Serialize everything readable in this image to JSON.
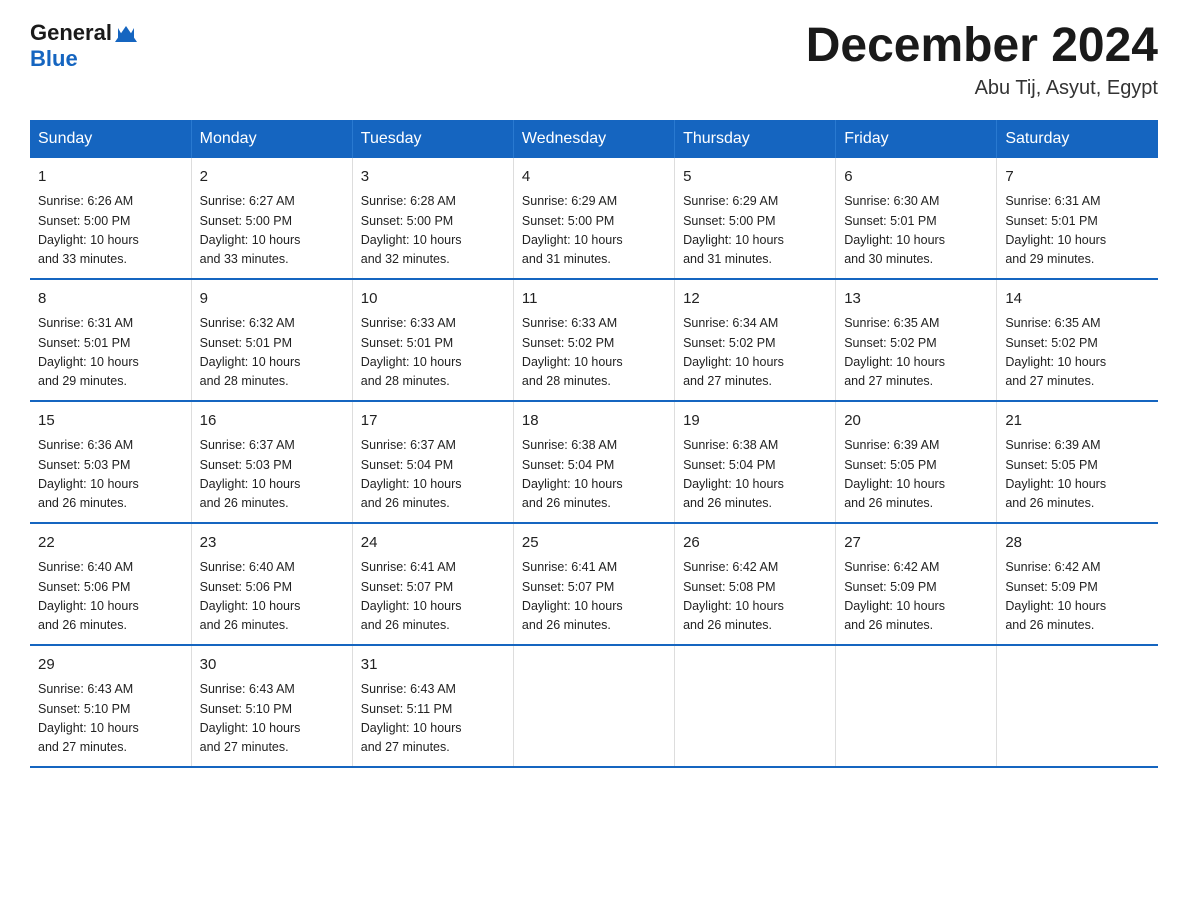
{
  "header": {
    "logo_text_general": "General",
    "logo_text_blue": "Blue",
    "title": "December 2024",
    "subtitle": "Abu Tij, Asyut, Egypt"
  },
  "days_of_week": [
    "Sunday",
    "Monday",
    "Tuesday",
    "Wednesday",
    "Thursday",
    "Friday",
    "Saturday"
  ],
  "weeks": [
    [
      {
        "day": "1",
        "sunrise": "6:26 AM",
        "sunset": "5:00 PM",
        "daylight": "10 hours and 33 minutes."
      },
      {
        "day": "2",
        "sunrise": "6:27 AM",
        "sunset": "5:00 PM",
        "daylight": "10 hours and 33 minutes."
      },
      {
        "day": "3",
        "sunrise": "6:28 AM",
        "sunset": "5:00 PM",
        "daylight": "10 hours and 32 minutes."
      },
      {
        "day": "4",
        "sunrise": "6:29 AM",
        "sunset": "5:00 PM",
        "daylight": "10 hours and 31 minutes."
      },
      {
        "day": "5",
        "sunrise": "6:29 AM",
        "sunset": "5:00 PM",
        "daylight": "10 hours and 31 minutes."
      },
      {
        "day": "6",
        "sunrise": "6:30 AM",
        "sunset": "5:01 PM",
        "daylight": "10 hours and 30 minutes."
      },
      {
        "day": "7",
        "sunrise": "6:31 AM",
        "sunset": "5:01 PM",
        "daylight": "10 hours and 29 minutes."
      }
    ],
    [
      {
        "day": "8",
        "sunrise": "6:31 AM",
        "sunset": "5:01 PM",
        "daylight": "10 hours and 29 minutes."
      },
      {
        "day": "9",
        "sunrise": "6:32 AM",
        "sunset": "5:01 PM",
        "daylight": "10 hours and 28 minutes."
      },
      {
        "day": "10",
        "sunrise": "6:33 AM",
        "sunset": "5:01 PM",
        "daylight": "10 hours and 28 minutes."
      },
      {
        "day": "11",
        "sunrise": "6:33 AM",
        "sunset": "5:02 PM",
        "daylight": "10 hours and 28 minutes."
      },
      {
        "day": "12",
        "sunrise": "6:34 AM",
        "sunset": "5:02 PM",
        "daylight": "10 hours and 27 minutes."
      },
      {
        "day": "13",
        "sunrise": "6:35 AM",
        "sunset": "5:02 PM",
        "daylight": "10 hours and 27 minutes."
      },
      {
        "day": "14",
        "sunrise": "6:35 AM",
        "sunset": "5:02 PM",
        "daylight": "10 hours and 27 minutes."
      }
    ],
    [
      {
        "day": "15",
        "sunrise": "6:36 AM",
        "sunset": "5:03 PM",
        "daylight": "10 hours and 26 minutes."
      },
      {
        "day": "16",
        "sunrise": "6:37 AM",
        "sunset": "5:03 PM",
        "daylight": "10 hours and 26 minutes."
      },
      {
        "day": "17",
        "sunrise": "6:37 AM",
        "sunset": "5:04 PM",
        "daylight": "10 hours and 26 minutes."
      },
      {
        "day": "18",
        "sunrise": "6:38 AM",
        "sunset": "5:04 PM",
        "daylight": "10 hours and 26 minutes."
      },
      {
        "day": "19",
        "sunrise": "6:38 AM",
        "sunset": "5:04 PM",
        "daylight": "10 hours and 26 minutes."
      },
      {
        "day": "20",
        "sunrise": "6:39 AM",
        "sunset": "5:05 PM",
        "daylight": "10 hours and 26 minutes."
      },
      {
        "day": "21",
        "sunrise": "6:39 AM",
        "sunset": "5:05 PM",
        "daylight": "10 hours and 26 minutes."
      }
    ],
    [
      {
        "day": "22",
        "sunrise": "6:40 AM",
        "sunset": "5:06 PM",
        "daylight": "10 hours and 26 minutes."
      },
      {
        "day": "23",
        "sunrise": "6:40 AM",
        "sunset": "5:06 PM",
        "daylight": "10 hours and 26 minutes."
      },
      {
        "day": "24",
        "sunrise": "6:41 AM",
        "sunset": "5:07 PM",
        "daylight": "10 hours and 26 minutes."
      },
      {
        "day": "25",
        "sunrise": "6:41 AM",
        "sunset": "5:07 PM",
        "daylight": "10 hours and 26 minutes."
      },
      {
        "day": "26",
        "sunrise": "6:42 AM",
        "sunset": "5:08 PM",
        "daylight": "10 hours and 26 minutes."
      },
      {
        "day": "27",
        "sunrise": "6:42 AM",
        "sunset": "5:09 PM",
        "daylight": "10 hours and 26 minutes."
      },
      {
        "day": "28",
        "sunrise": "6:42 AM",
        "sunset": "5:09 PM",
        "daylight": "10 hours and 26 minutes."
      }
    ],
    [
      {
        "day": "29",
        "sunrise": "6:43 AM",
        "sunset": "5:10 PM",
        "daylight": "10 hours and 27 minutes."
      },
      {
        "day": "30",
        "sunrise": "6:43 AM",
        "sunset": "5:10 PM",
        "daylight": "10 hours and 27 minutes."
      },
      {
        "day": "31",
        "sunrise": "6:43 AM",
        "sunset": "5:11 PM",
        "daylight": "10 hours and 27 minutes."
      },
      {
        "day": "",
        "sunrise": "",
        "sunset": "",
        "daylight": ""
      },
      {
        "day": "",
        "sunrise": "",
        "sunset": "",
        "daylight": ""
      },
      {
        "day": "",
        "sunrise": "",
        "sunset": "",
        "daylight": ""
      },
      {
        "day": "",
        "sunrise": "",
        "sunset": "",
        "daylight": ""
      }
    ]
  ],
  "labels": {
    "sunrise_prefix": "Sunrise: ",
    "sunset_prefix": "Sunset: ",
    "daylight_prefix": "Daylight: "
  },
  "colors": {
    "header_bg": "#1565c0",
    "border": "#1565c0",
    "logo_blue": "#1565c0"
  }
}
